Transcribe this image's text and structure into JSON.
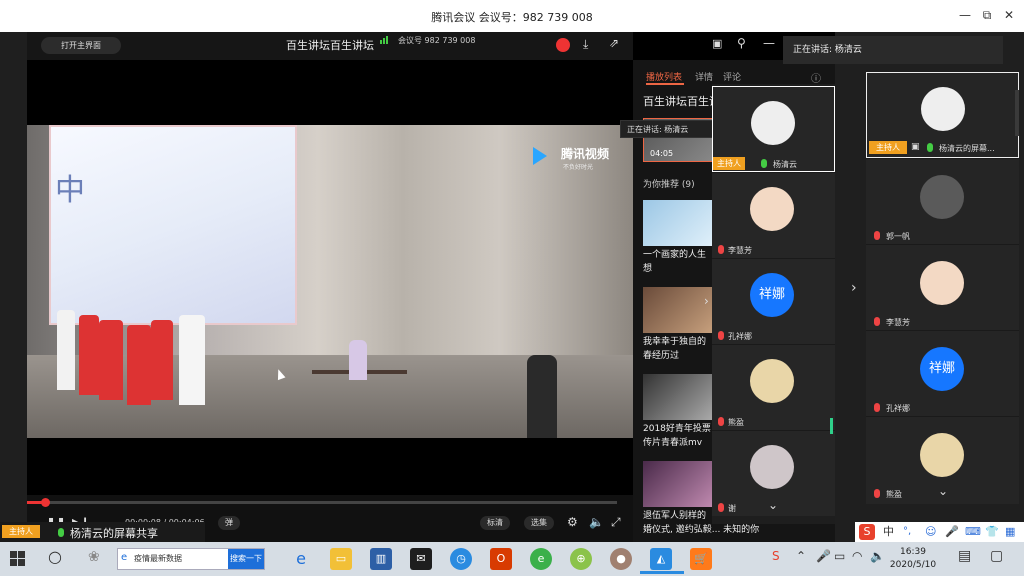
{
  "titlebar": {
    "title": "腾讯会议  会议号：982 739 008",
    "minimize": "—",
    "restore": "⧉",
    "close": "✕"
  },
  "player": {
    "home_button": "打开主界面",
    "title": "百生讲坛百生讲坛",
    "meeting_no": "会议号 982 739 008",
    "watermark": "腾讯视频",
    "watermark_sub": "不负好时光",
    "time": "00:00:08 / 00:04:06",
    "danmu": "弹",
    "quality": "标清",
    "episodes": "选集"
  },
  "playlist": {
    "tabs": [
      "播放列表",
      "详情",
      "评论"
    ],
    "current_title": "百生讲坛百生讲",
    "current_duration": "04:05",
    "recommend_label": "为你推荐 (9)",
    "items": [
      {
        "line1": "一个画家的人生",
        "line2": "想"
      },
      {
        "line1": "我幸幸于独自的",
        "line2": "春经历过"
      },
      {
        "line1": "2018好青年投票",
        "line2": "传片青春派mv"
      },
      {
        "line1": "退伍军人别样的",
        "line2": "婚仪式, 邀约弘毅...  未知的你"
      }
    ]
  },
  "speaking": {
    "label": "正在讲话: 杨清云",
    "tooltip": "正在讲话: 杨清云"
  },
  "participants_mid": [
    {
      "name": "杨清云",
      "host": "主持人"
    },
    {
      "name": "李慧芳"
    },
    {
      "name": "孔祥娜",
      "avatar_text": "祥娜"
    },
    {
      "name": "熊盈"
    },
    {
      "name": "谢"
    }
  ],
  "participants_right": [
    {
      "name": "杨清云的屏幕...",
      "host": "主持人"
    },
    {
      "name": "郭一帆"
    },
    {
      "name": "李慧芳"
    },
    {
      "name": "孔祥娜",
      "avatar_text": "祥娜"
    },
    {
      "name": "熊盈"
    }
  ],
  "share": {
    "host": "主持人",
    "label": "杨清云的屏幕共享"
  },
  "taskbar": {
    "search_text": "疫情最新数据",
    "search_button": "搜索一下",
    "time": "16:39",
    "date": "2020/5/10",
    "ime_label": "中"
  },
  "colors": {
    "accent": "#e64a2e",
    "host": "#f0a020",
    "avatar_blue": "#1677ff"
  }
}
